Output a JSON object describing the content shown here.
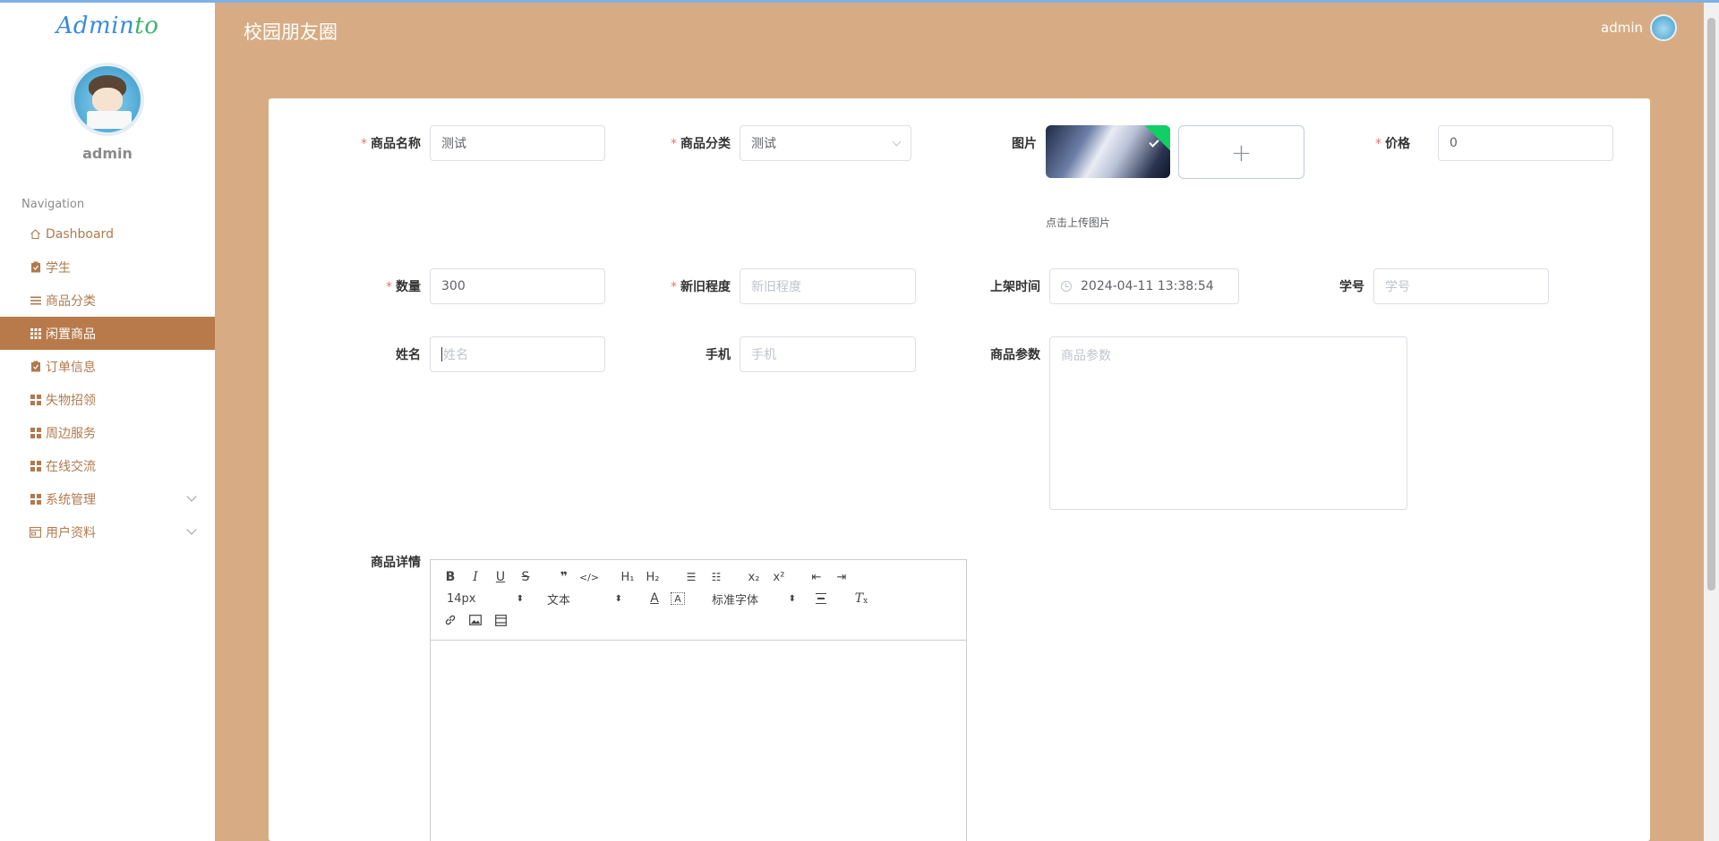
{
  "app": {
    "logo_main": "Admin",
    "logo_accent": "to",
    "title": "校园朋友圈",
    "user": "admin"
  },
  "sidebar": {
    "username": "admin",
    "nav_title": "Navigation",
    "items": [
      {
        "label": "Dashboard",
        "icon": "home-icon"
      },
      {
        "label": "学生",
        "icon": "clipboard-icon"
      },
      {
        "label": "商品分类",
        "icon": "list-icon"
      },
      {
        "label": "闲置商品",
        "icon": "grid-icon",
        "active": true
      },
      {
        "label": "订单信息",
        "icon": "clipboard-icon"
      },
      {
        "label": "失物招领",
        "icon": "grid-icon"
      },
      {
        "label": "周边服务",
        "icon": "grid-icon"
      },
      {
        "label": "在线交流",
        "icon": "grid-icon"
      },
      {
        "label": "系统管理",
        "icon": "grid-icon",
        "expandable": true
      },
      {
        "label": "用户资料",
        "icon": "window-icon",
        "expandable": true
      }
    ]
  },
  "form": {
    "name": {
      "label": "商品名称",
      "value": "测试"
    },
    "category": {
      "label": "商品分类",
      "value": "测试"
    },
    "image": {
      "label": "图片",
      "tip": "点击上传图片"
    },
    "price": {
      "label": "价格",
      "value": "0"
    },
    "quantity": {
      "label": "数量",
      "value": "300"
    },
    "condition": {
      "label": "新旧程度",
      "placeholder": "新旧程度"
    },
    "list_time": {
      "label": "上架时间",
      "value": "2024-04-11 13:38:54"
    },
    "student_no": {
      "label": "学号",
      "placeholder": "学号"
    },
    "real_name": {
      "label": "姓名",
      "placeholder": "姓名"
    },
    "phone": {
      "label": "手机",
      "placeholder": "手机"
    },
    "params": {
      "label": "商品参数",
      "placeholder": "商品参数"
    },
    "detail": {
      "label": "商品详情"
    }
  },
  "editor": {
    "font_size": "14px",
    "header": "文本",
    "font": "标准字体"
  },
  "colors": {
    "background": "#d7ac84",
    "active_nav": "#b87a4b",
    "nav_text": "#b07a4e",
    "required": "#f56c6c"
  }
}
